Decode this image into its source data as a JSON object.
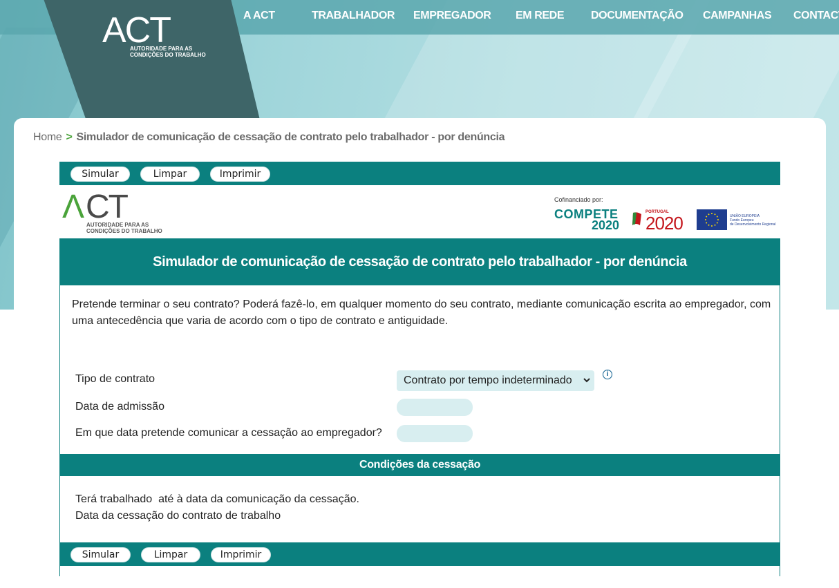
{
  "header": {
    "logo_text": "ACT",
    "logo_sub": "AUTORIDADE PARA AS CONDIÇÕES DO TRABALHO",
    "nav": [
      "A ACT",
      "TRABALHADOR",
      "EMPREGADOR",
      "EM REDE",
      "DOCUMENTAÇÃO",
      "CAMPANHAS",
      "CONTACT"
    ]
  },
  "breadcrumb": {
    "home": "Home",
    "separator": ">",
    "current": "Simulador de comunicação de cessação de contrato pelo trabalhador - por denúncia"
  },
  "toolbar": {
    "simular": "Simular",
    "limpar": "Limpar",
    "imprimir": "Imprimir"
  },
  "logos": {
    "act": "ACT",
    "act_sub_1": "AUTORIDADE PARA AS",
    "act_sub_2": "CONDIÇÕES DO TRABALHO",
    "cofinanciado": "Cofinanciado por:",
    "compete_1": "COMPETE",
    "compete_2": "2020",
    "portugal_label": "PORTUGAL",
    "portugal_year": "2020",
    "eu_1": "UNIÃO EUROPEIA",
    "eu_2": "Fundo Europeu",
    "eu_3": "de Desenvolvimento Regional"
  },
  "title": "Simulador de comunicação de cessação de contrato pelo trabalhador - por denúncia",
  "intro": "Pretende terminar o seu contrato? Poderá fazê-lo, em qualquer momento do seu contrato, mediante comunicação escrita ao empregador, com uma antecedência que varia de acordo com o tipo de contrato e antiguidade.",
  "form": {
    "tipo_label": "Tipo de contrato",
    "tipo_value": "Contrato por tempo indeterminado",
    "admissao_label": "Data de admissão",
    "admissao_value": "",
    "comunicacao_label": "Em que data pretende comunicar a cessação ao empregador?",
    "comunicacao_value": ""
  },
  "section": "Condições da cessação",
  "results": {
    "line1": "Terá trabalhado  até à data da comunicação da cessação.",
    "line2": "Data da cessação do contrato de trabalho"
  },
  "colors": {
    "teal": "#0b807f",
    "green": "#4aa33a",
    "field": "#d8eef0"
  }
}
